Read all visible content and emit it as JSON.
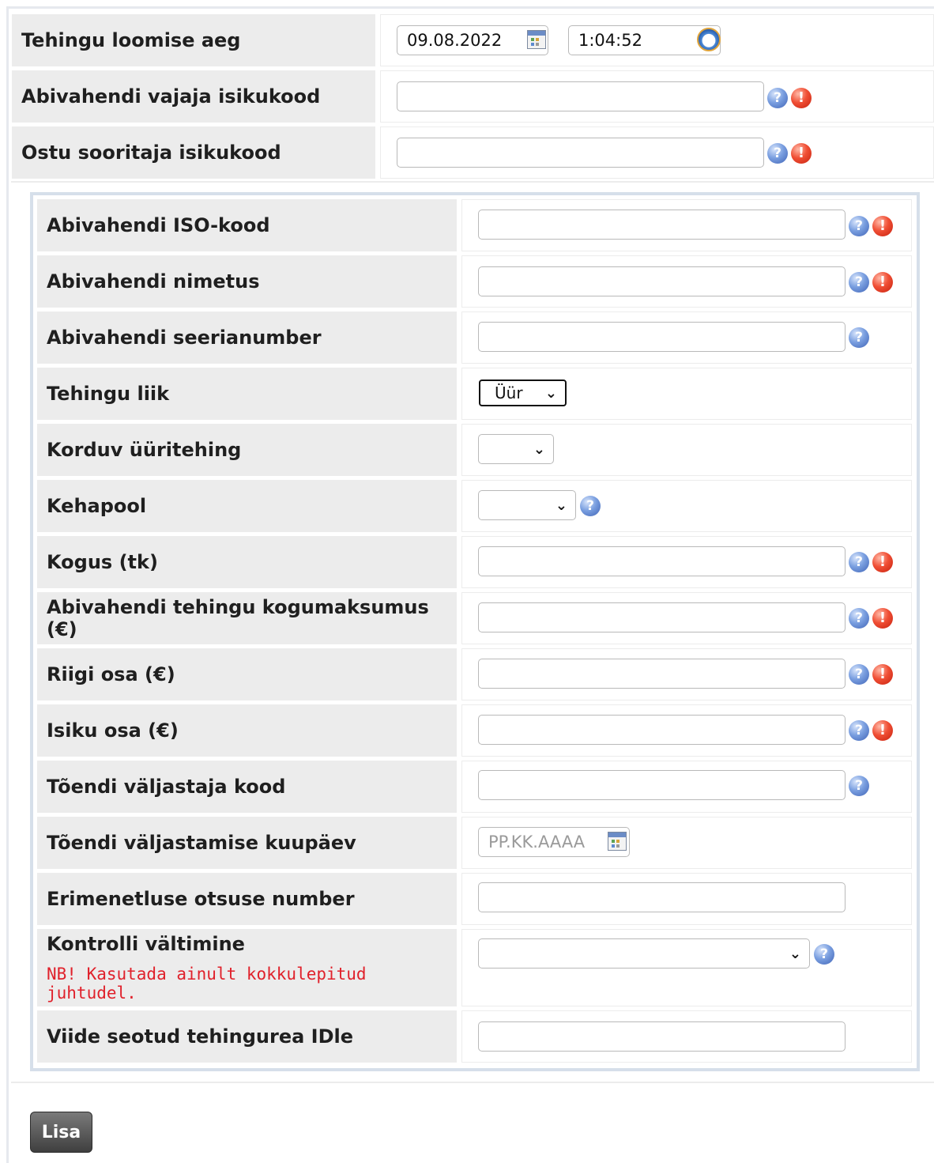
{
  "header_fields": {
    "creation_time": {
      "label": "Tehingu loomise aeg",
      "date": "09.08.2022",
      "time": "1:04:52"
    },
    "needer_id": {
      "label": "Abivahendi vajaja isikukood",
      "value": ""
    },
    "buyer_id": {
      "label": "Ostu sooritaja isikukood",
      "value": ""
    }
  },
  "form": {
    "iso_code": {
      "label": "Abivahendi ISO-kood",
      "value": ""
    },
    "name": {
      "label": "Abivahendi nimetus",
      "value": ""
    },
    "serial": {
      "label": "Abivahendi seerianumber",
      "value": ""
    },
    "transaction_type": {
      "label": "Tehingu liik",
      "selected": "Üür"
    },
    "recurring_rent": {
      "label": "Korduv üüritehing",
      "selected": ""
    },
    "body_side": {
      "label": "Kehapool",
      "selected": ""
    },
    "quantity": {
      "label": "Kogus (tk)",
      "value": ""
    },
    "total_cost": {
      "label": "Abivahendi tehingu kogumaksumus (€)",
      "value": ""
    },
    "state_share": {
      "label": "Riigi osa (€)",
      "value": ""
    },
    "person_share": {
      "label": "Isiku osa (€)",
      "value": ""
    },
    "certificate_issuer": {
      "label": "Tõendi väljastaja kood",
      "value": ""
    },
    "certificate_date": {
      "label": "Tõendi väljastamise kuupäev",
      "placeholder": "PP.KK.AAAA"
    },
    "special_procedure": {
      "label": "Erimenetluse otsuse number",
      "value": ""
    },
    "control_avoid": {
      "label": "Kontrolli vältimine",
      "warning": "NB! Kasutada ainult kokkulepitud juhtudel.",
      "selected": ""
    },
    "linked_row": {
      "label": "Viide seotud tehingurea IDle",
      "value": ""
    }
  },
  "icons": {
    "help": "help-icon",
    "required": "required-icon",
    "calendar": "calendar-icon",
    "clock": "clock-icon"
  },
  "colors": {
    "label_bg": "#ececec",
    "warning": "#e0212b",
    "button": "#555555"
  },
  "actions": {
    "add_label": "Lisa"
  }
}
